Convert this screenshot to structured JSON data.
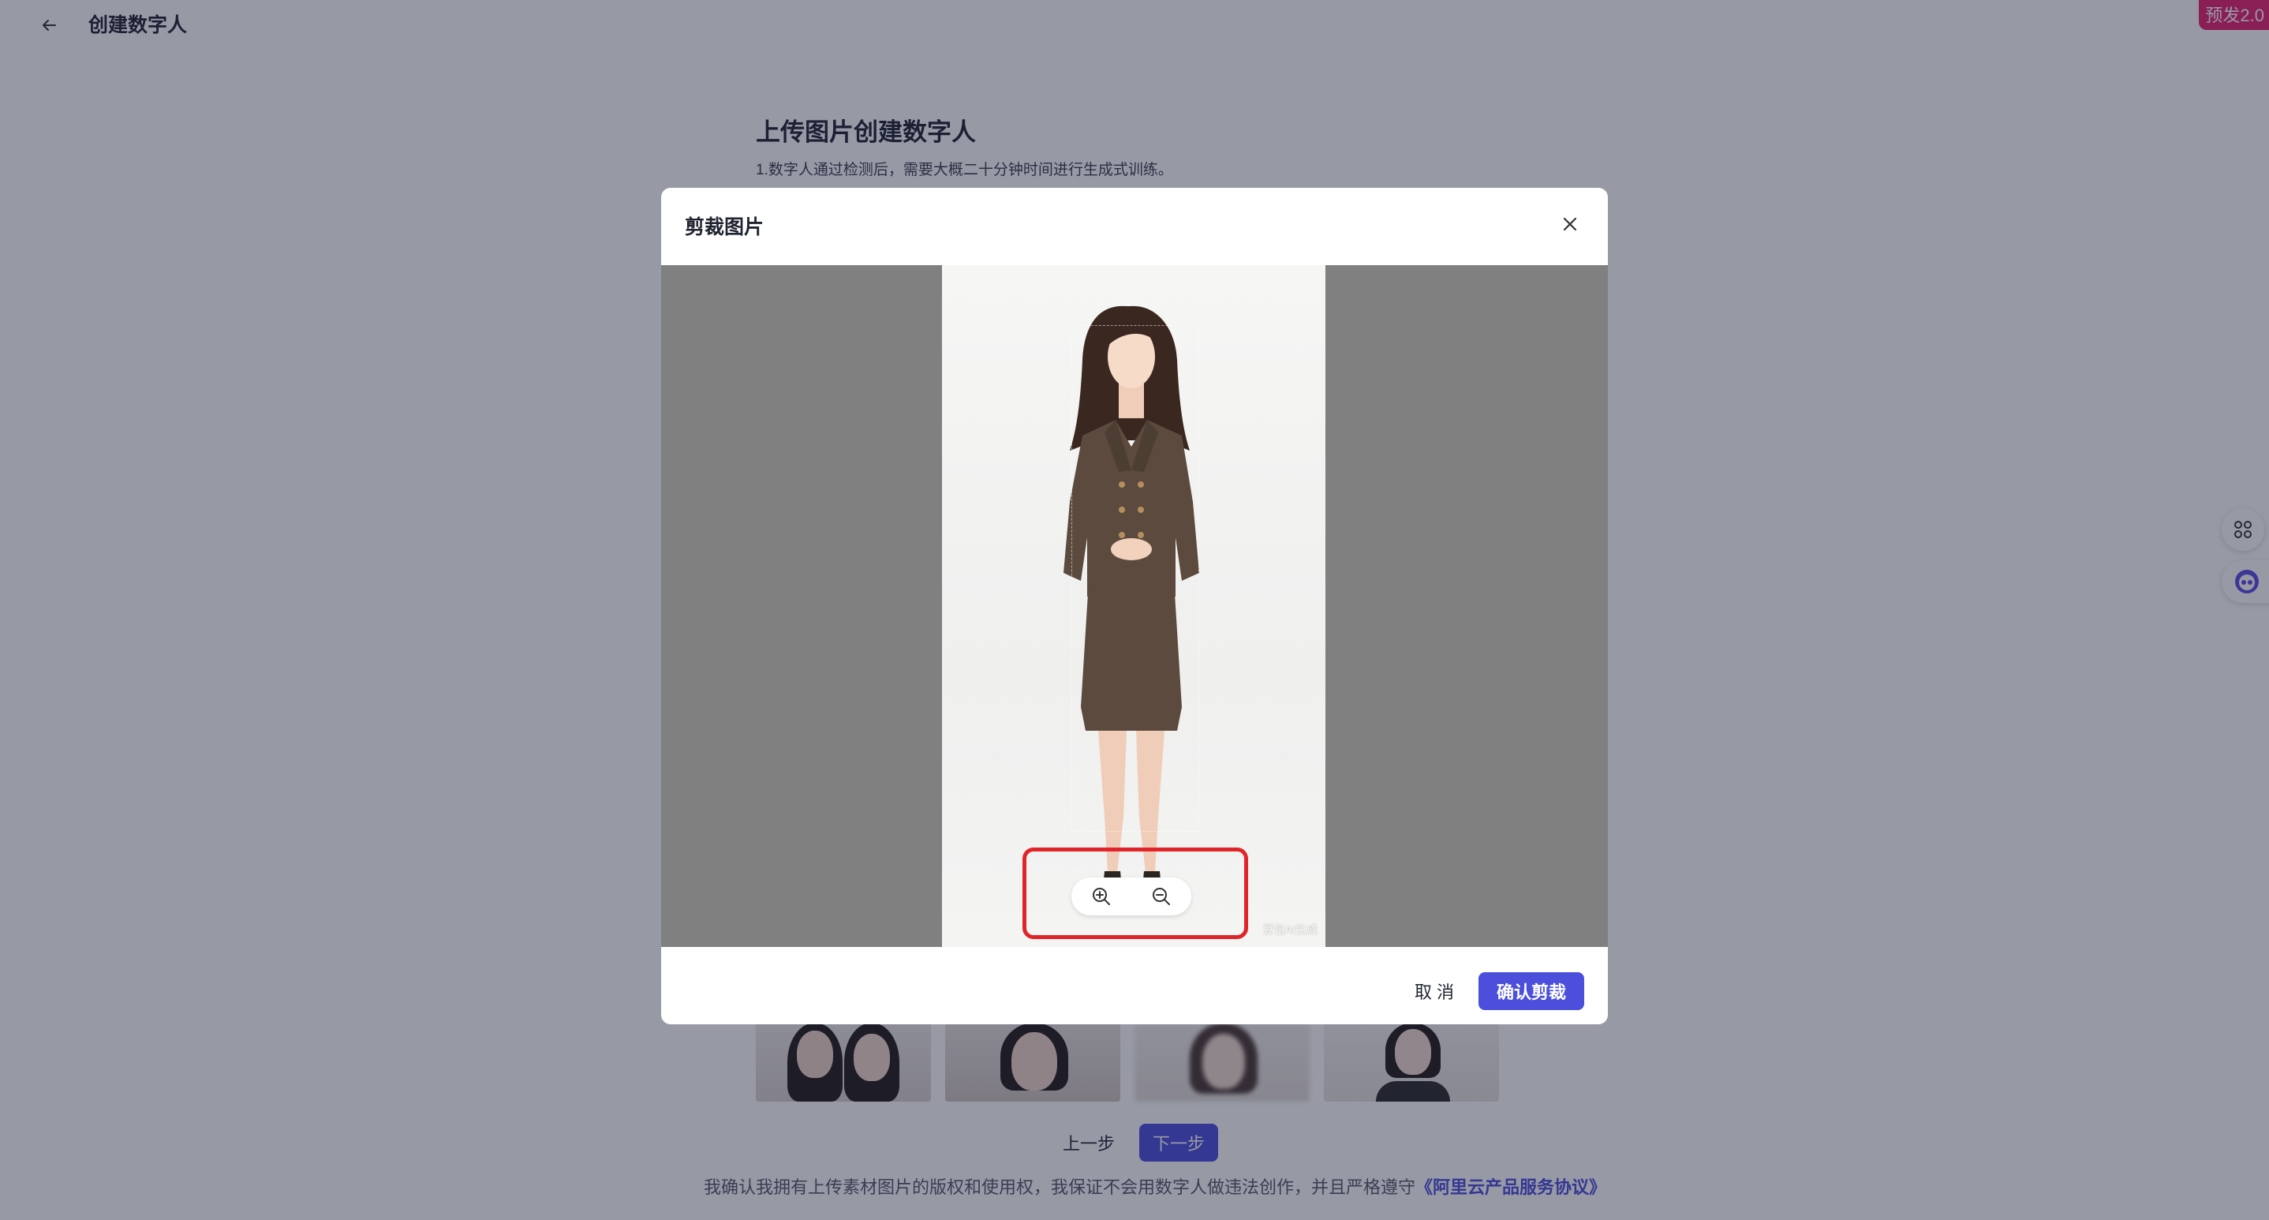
{
  "header": {
    "title": "创建数字人",
    "env_badge": "预发2.0"
  },
  "content": {
    "title": "上传图片创建数字人",
    "desc_line1": "1.数字人通过检测后，需要大概二十分钟时间进行生成式训练。",
    "desc_line2": ""
  },
  "nav": {
    "prev_label": "上一步",
    "next_label": "下一步"
  },
  "agreement": {
    "text": "我确认我拥有上传素材图片的版权和使用权，我保证不会用数字人做违法创作，并且严格遵守",
    "link": "《阿里云产品服务协议》"
  },
  "modal": {
    "title": "剪裁图片",
    "cancel_label": "取 消",
    "confirm_label": "确认剪裁",
    "watermark": "豆包AI生成",
    "zoom_in_icon": "zoom-in-icon",
    "zoom_out_icon": "zoom-out-icon"
  },
  "colors": {
    "primary": "#4b4fdc",
    "highlight": "#e0242a",
    "badge": "#e6226e"
  }
}
